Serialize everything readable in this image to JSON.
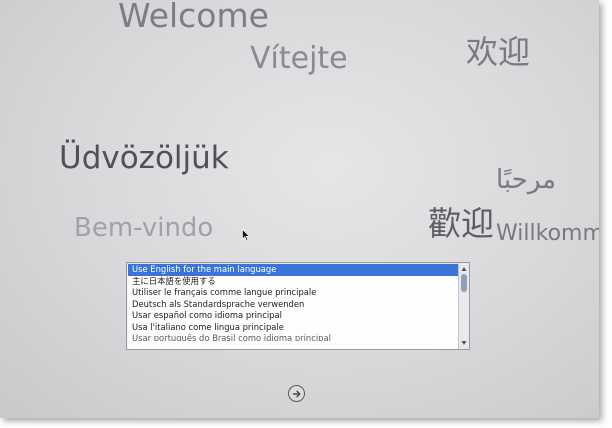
{
  "greetings": {
    "welcome": "Welcome",
    "czech": "Vítejte",
    "chinese_simplified": "欢迎",
    "hungarian": "Üdvözöljük",
    "arabic": "مرحبًا",
    "chinese_traditional": "歡迎",
    "portuguese": "Bem-vindo",
    "german": "Willkomm"
  },
  "language_list": {
    "items": [
      "Use English for the main language",
      "主に日本語を使用する",
      "Utiliser le français comme langue principale",
      "Deutsch als Standardsprache verwenden",
      "Usar español como idioma principal",
      "Usa l'italiano come lingua principale",
      "Usar português do Brasil como idioma principal"
    ],
    "selected_index": 0
  },
  "icons": {
    "cursor": "arrow-cursor-icon",
    "continue": "right-arrow-circle-icon",
    "scroll_up": "scroll-up-arrow-icon",
    "scroll_down": "scroll-down-arrow-icon"
  },
  "colors": {
    "selection": "#3b74d9",
    "background": "#d8d8da"
  }
}
